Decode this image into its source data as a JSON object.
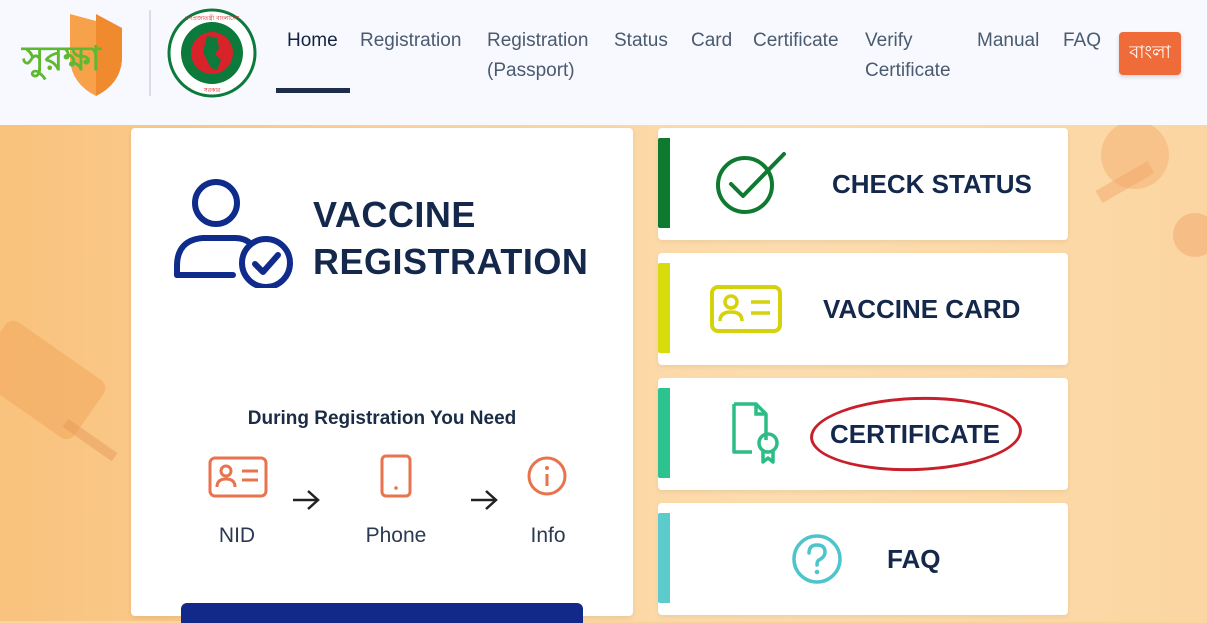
{
  "brand": {
    "logo_text": "সুরক্ষা",
    "gov_seal_text_top": "গণপ্রজাতন্ত্রী বাংলাদেশ",
    "gov_seal_text_bottom": "সরকার"
  },
  "nav": {
    "items": [
      {
        "label": "Home",
        "active": true
      },
      {
        "label": "Registration"
      },
      {
        "line1": "Registration",
        "line2": "(Passport)"
      },
      {
        "label": "Status"
      },
      {
        "label": "Card"
      },
      {
        "label": "Certificate"
      },
      {
        "line1": "Verify",
        "line2": "Certificate"
      },
      {
        "label": "Manual"
      },
      {
        "label": "FAQ"
      }
    ],
    "language_button": "বাংলা"
  },
  "registration": {
    "title_line1": "VACCINE",
    "title_line2": "REGISTRATION",
    "need_title": "During Registration You Need",
    "steps": [
      {
        "label": "NID",
        "icon": "id-card-icon"
      },
      {
        "label": "Phone",
        "icon": "phone-icon"
      },
      {
        "label": "Info",
        "icon": "info-icon"
      }
    ]
  },
  "actions": [
    {
      "label": "CHECK STATUS",
      "color": "#0e7a2f",
      "icon": "check-circle-icon"
    },
    {
      "label": "VACCINE CARD",
      "color": "#d8dc0c",
      "icon": "id-card-icon"
    },
    {
      "label": "CERTIFICATE",
      "color": "#2cc38f",
      "icon": "certificate-icon"
    },
    {
      "label": "FAQ",
      "color": "#5ccbcb",
      "icon": "question-circle-icon"
    }
  ],
  "colors": {
    "navy": "#14284b",
    "accent_orange": "#ef6c3a",
    "registration_button": "#12298a",
    "annotation_circle": "#c8202a"
  }
}
